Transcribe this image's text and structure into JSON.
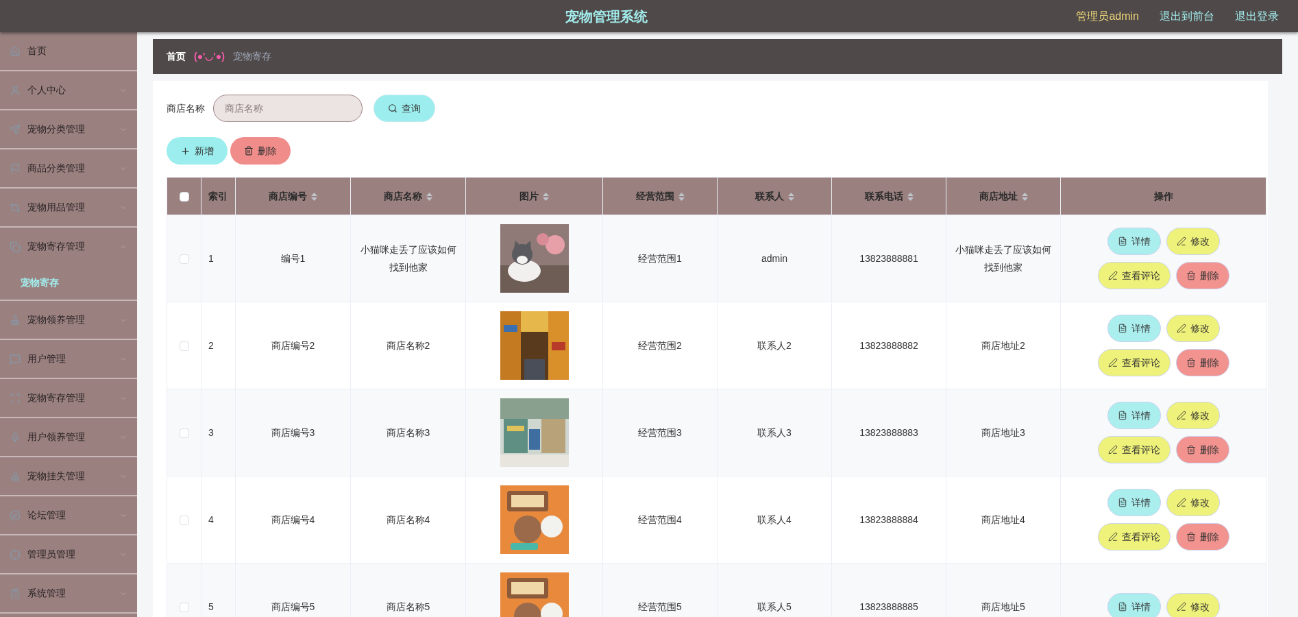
{
  "header": {
    "title": "宠物管理系统",
    "user": "管理员admin",
    "links": [
      "退出到前台",
      "退出登录"
    ]
  },
  "sidebar": {
    "items": [
      {
        "label": "首页",
        "expandable": false,
        "expanded": false
      },
      {
        "label": "个人中心",
        "expandable": true,
        "expanded": false
      },
      {
        "label": "宠物分类管理",
        "expandable": true,
        "expanded": false
      },
      {
        "label": "商品分类管理",
        "expandable": true,
        "expanded": false
      },
      {
        "label": "宠物用品管理",
        "expandable": true,
        "expanded": false
      },
      {
        "label": "宠物寄存管理",
        "expandable": true,
        "expanded": true,
        "children": [
          {
            "label": "宠物寄存",
            "selected": true
          }
        ]
      },
      {
        "label": "宠物领养管理",
        "expandable": true,
        "expanded": false
      },
      {
        "label": "用户管理",
        "expandable": true,
        "expanded": false
      },
      {
        "label": "宠物寄存管理",
        "expandable": true,
        "expanded": false
      },
      {
        "label": "用户领养管理",
        "expandable": true,
        "expanded": false
      },
      {
        "label": "宠物挂失管理",
        "expandable": true,
        "expanded": false
      },
      {
        "label": "论坛管理",
        "expandable": true,
        "expanded": false
      },
      {
        "label": "管理员管理",
        "expandable": true,
        "expanded": false
      },
      {
        "label": "系统管理",
        "expandable": true,
        "expanded": false
      }
    ]
  },
  "breadcrumb": {
    "home": "首页",
    "separator": "(●'◡'●)",
    "current": "宠物寄存"
  },
  "search": {
    "label": "商店名称",
    "placeholder": "商店名称",
    "button": "查询"
  },
  "toolbar": [
    {
      "kind": "add",
      "label": "新增"
    },
    {
      "kind": "delete",
      "label": "删除"
    }
  ],
  "table": {
    "select_all_checked": false,
    "columns": [
      {
        "label": "索引",
        "sortable": false
      },
      {
        "label": "商店编号",
        "sortable": true
      },
      {
        "label": "商店名称",
        "sortable": true
      },
      {
        "label": "图片",
        "sortable": true
      },
      {
        "label": "经营范围",
        "sortable": true
      },
      {
        "label": "联系人",
        "sortable": true
      },
      {
        "label": "联系电话",
        "sortable": true
      },
      {
        "label": "商店地址",
        "sortable": true
      },
      {
        "label": "操作",
        "sortable": false
      }
    ],
    "rows": [
      {
        "checked": false,
        "cells": [
          "1",
          "编号1",
          "小猫咪走丢了应该如何找到他家",
          {
            "kind": "picture"
          },
          "经营范围1",
          "admin",
          "13823888881",
          "小猫咪走丢了应该如何找到他家"
        ],
        "actions": [
          {
            "kind": "detail",
            "label": "详情"
          },
          {
            "kind": "edit",
            "label": "修改"
          },
          {
            "kind": "comment",
            "label": "查看评论"
          },
          {
            "kind": "delete",
            "label": "删除"
          }
        ]
      },
      {
        "checked": false,
        "cells": [
          "2",
          "商店编号2",
          "商店名称2",
          {
            "kind": "picture"
          },
          "经营范围2",
          "联系人2",
          "13823888882",
          "商店地址2"
        ],
        "actions": [
          {
            "kind": "detail",
            "label": "详情"
          },
          {
            "kind": "edit",
            "label": "修改"
          },
          {
            "kind": "comment",
            "label": "查看评论"
          },
          {
            "kind": "delete",
            "label": "删除"
          }
        ]
      },
      {
        "checked": false,
        "cells": [
          "3",
          "商店编号3",
          "商店名称3",
          {
            "kind": "picture"
          },
          "经营范围3",
          "联系人3",
          "13823888883",
          "商店地址3"
        ],
        "actions": [
          {
            "kind": "detail",
            "label": "详情"
          },
          {
            "kind": "edit",
            "label": "修改"
          },
          {
            "kind": "comment",
            "label": "查看评论"
          },
          {
            "kind": "delete",
            "label": "删除"
          }
        ]
      },
      {
        "checked": false,
        "cells": [
          "4",
          "商店编号4",
          "商店名称4",
          {
            "kind": "picture"
          },
          "经营范围4",
          "联系人4",
          "13823888884",
          "商店地址4"
        ],
        "actions": [
          {
            "kind": "detail",
            "label": "详情"
          },
          {
            "kind": "edit",
            "label": "修改"
          },
          {
            "kind": "comment",
            "label": "查看评论"
          },
          {
            "kind": "delete",
            "label": "删除"
          }
        ]
      },
      {
        "checked": false,
        "cells": [
          "5",
          "商店编号5",
          "商店名称5",
          {
            "kind": "picture"
          },
          "经营范围5",
          "联系人5",
          "13823888885",
          "商店地址5"
        ],
        "actions": [
          {
            "kind": "detail",
            "label": "详情"
          },
          {
            "kind": "edit",
            "label": "修改"
          }
        ]
      }
    ]
  }
}
